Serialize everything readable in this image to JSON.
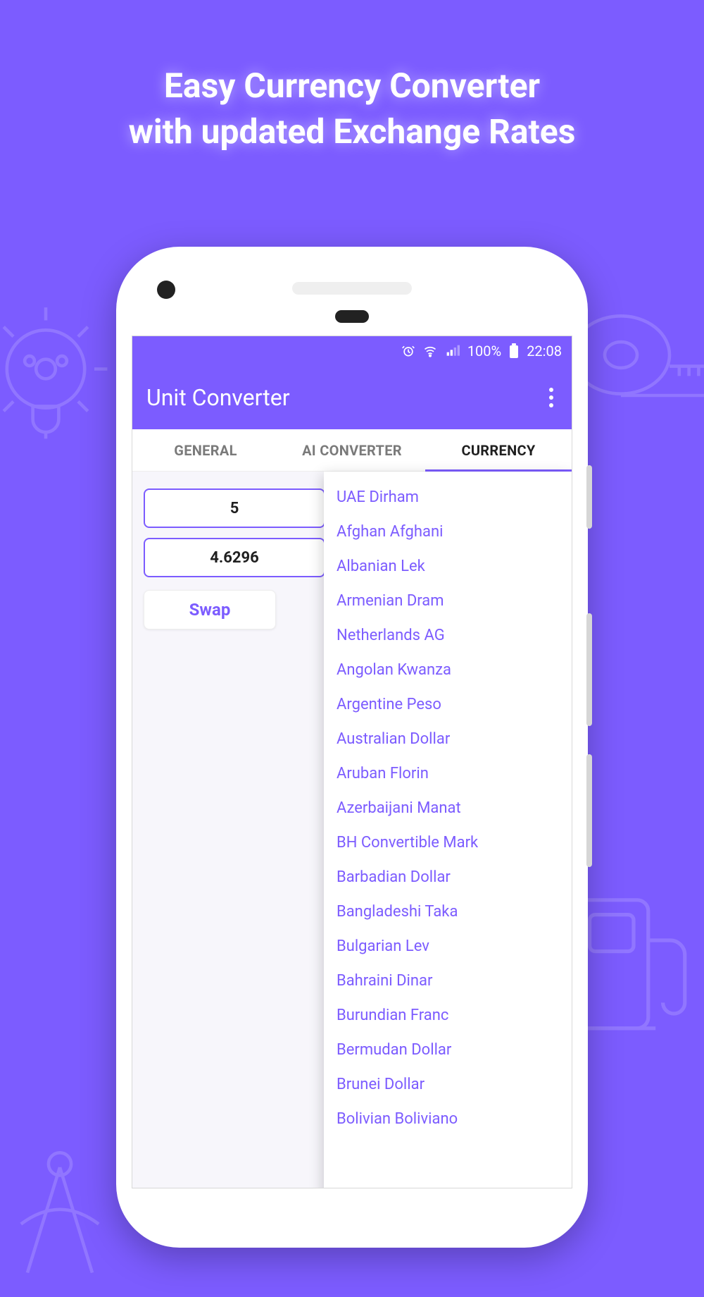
{
  "hero": {
    "line1": "Easy Currency Converter",
    "line2": "with updated Exchange Rates"
  },
  "status": {
    "battery_pct": "100%",
    "time": "22:08"
  },
  "app": {
    "title": "Unit Converter"
  },
  "tabs": {
    "general": "GENERAL",
    "ai": "AI CONVERTER",
    "currency": "CURRENCY"
  },
  "fields": {
    "from_value": "5",
    "to_value": "4.6296"
  },
  "buttons": {
    "swap": "Swap"
  },
  "currency_list": [
    "UAE Dirham",
    "Afghan Afghani",
    "Albanian Lek",
    "Armenian Dram",
    "Netherlands AG",
    "Angolan Kwanza",
    "Argentine Peso",
    "Australian Dollar",
    "Aruban Florin",
    "Azerbaijani Manat",
    "BH Convertible Mark",
    "Barbadian Dollar",
    "Bangladeshi Taka",
    "Bulgarian Lev",
    "Bahraini Dinar",
    "Burundian Franc",
    "Bermudan Dollar",
    "Brunei Dollar",
    "Bolivian Boliviano"
  ]
}
